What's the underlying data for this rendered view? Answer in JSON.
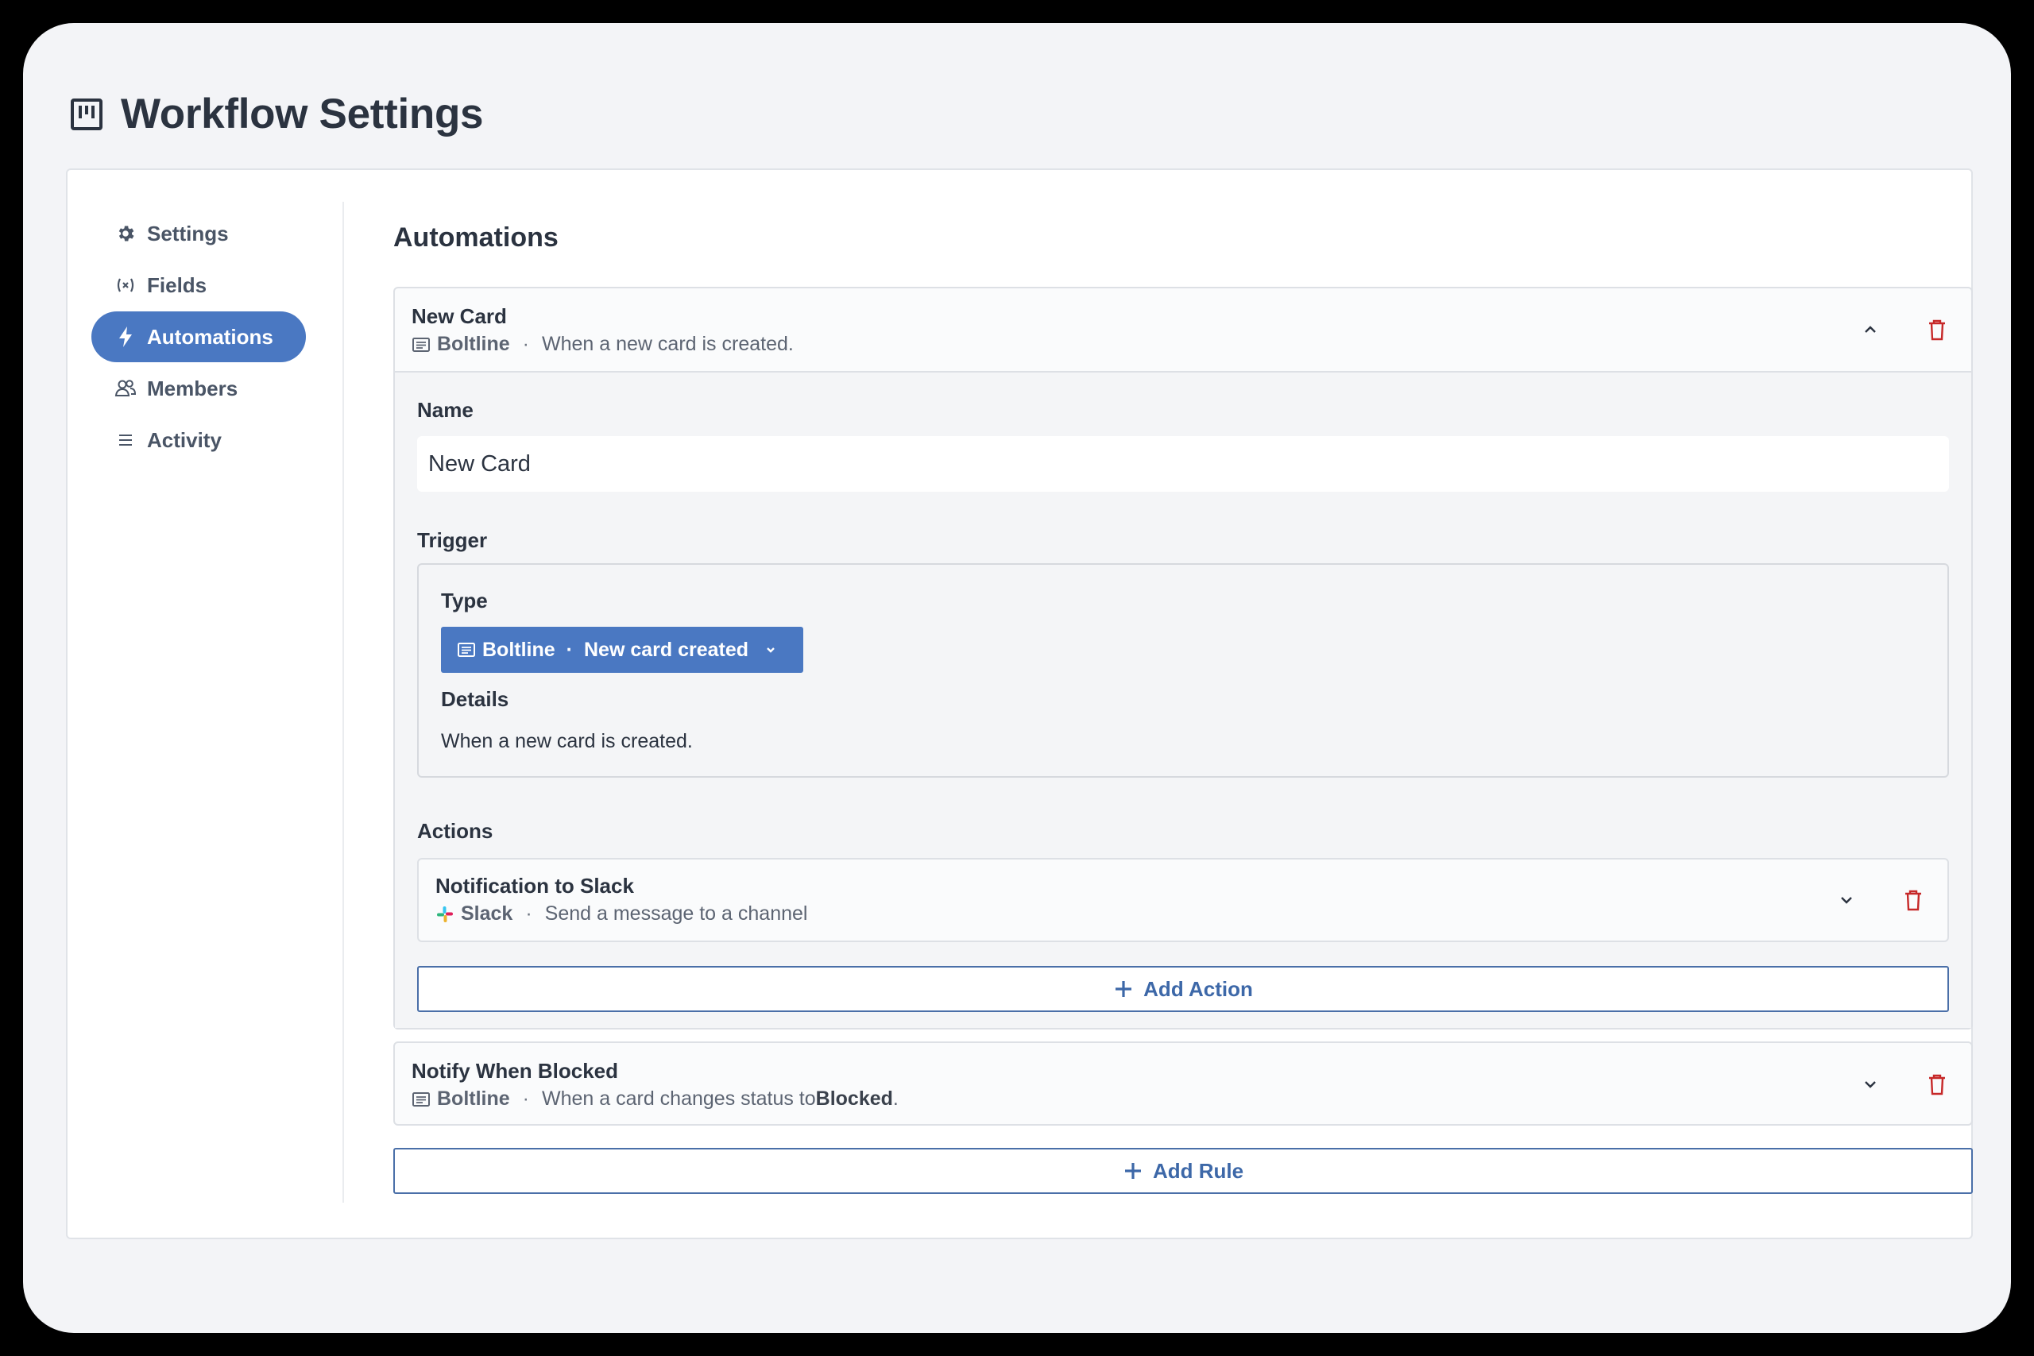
{
  "page": {
    "title": "Workflow Settings"
  },
  "sidebar": {
    "items": [
      {
        "label": "Settings",
        "icon": "gear-icon"
      },
      {
        "label": "Fields",
        "icon": "variable-icon"
      },
      {
        "label": "Automations",
        "icon": "bolt-icon",
        "active": true
      },
      {
        "label": "Members",
        "icon": "users-icon"
      },
      {
        "label": "Activity",
        "icon": "list-icon"
      }
    ]
  },
  "main": {
    "section_title": "Automations",
    "rules": [
      {
        "title": "New Card",
        "source": "Boltline",
        "source_icon": "document-icon",
        "separator": "·",
        "description": "When a new card is created.",
        "expanded": true,
        "form": {
          "name_label": "Name",
          "name_value": "New Card",
          "trigger_label": "Trigger",
          "type_label": "Type",
          "type_value": {
            "source": "Boltline",
            "separator": "·",
            "event": "New card created"
          },
          "details_label": "Details",
          "details_text": "When a new card is created.",
          "actions_label": "Actions",
          "actions": [
            {
              "title": "Notification to Slack",
              "source": "Slack",
              "source_icon": "slack-icon",
              "separator": "·",
              "description": "Send a message to a channel"
            }
          ],
          "add_action_label": "Add Action"
        }
      },
      {
        "title": "Notify When Blocked",
        "source": "Boltline",
        "source_icon": "document-icon",
        "separator": "·",
        "description_prefix": "When a card changes status to ",
        "description_bold": "Blocked",
        "description_suffix": ".",
        "expanded": false
      }
    ],
    "add_rule_label": "Add Rule"
  },
  "colors": {
    "accent": "#4a78c2",
    "danger": "#c62828",
    "outline": "#4a6fa8"
  }
}
